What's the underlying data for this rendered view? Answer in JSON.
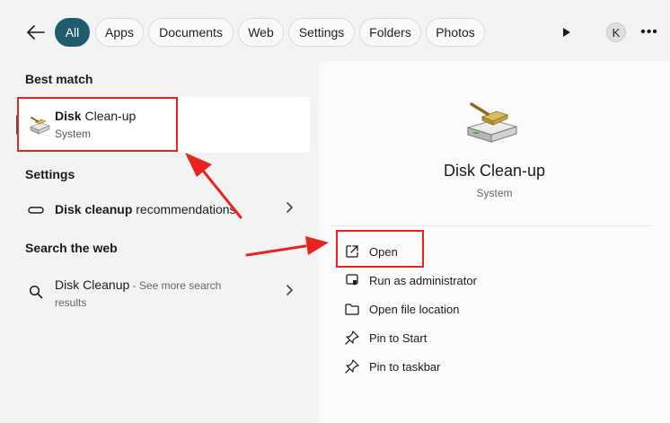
{
  "filters": [
    "All",
    "Apps",
    "Documents",
    "Web",
    "Settings",
    "Folders",
    "Photos"
  ],
  "account_initial": "K",
  "left": {
    "best_match_heading": "Best match",
    "best_match": {
      "title_bold": "Disk",
      "title_rest": " Clean-up",
      "subtitle": "System"
    },
    "settings_heading": "Settings",
    "settings_item": {
      "bold": "Disk cleanup",
      "rest": " recommendations"
    },
    "web_heading": "Search the web",
    "web_item": {
      "title": "Disk Cleanup",
      "suffix": " - See more search",
      "line2": "results"
    }
  },
  "detail": {
    "app_name": "Disk Clean-up",
    "category": "System",
    "actions": [
      "Open",
      "Run as administrator",
      "Open file location",
      "Pin to Start",
      "Pin to taskbar"
    ]
  },
  "colors": {
    "accent": "#1f5c6e",
    "annotation": "#e8241c"
  }
}
